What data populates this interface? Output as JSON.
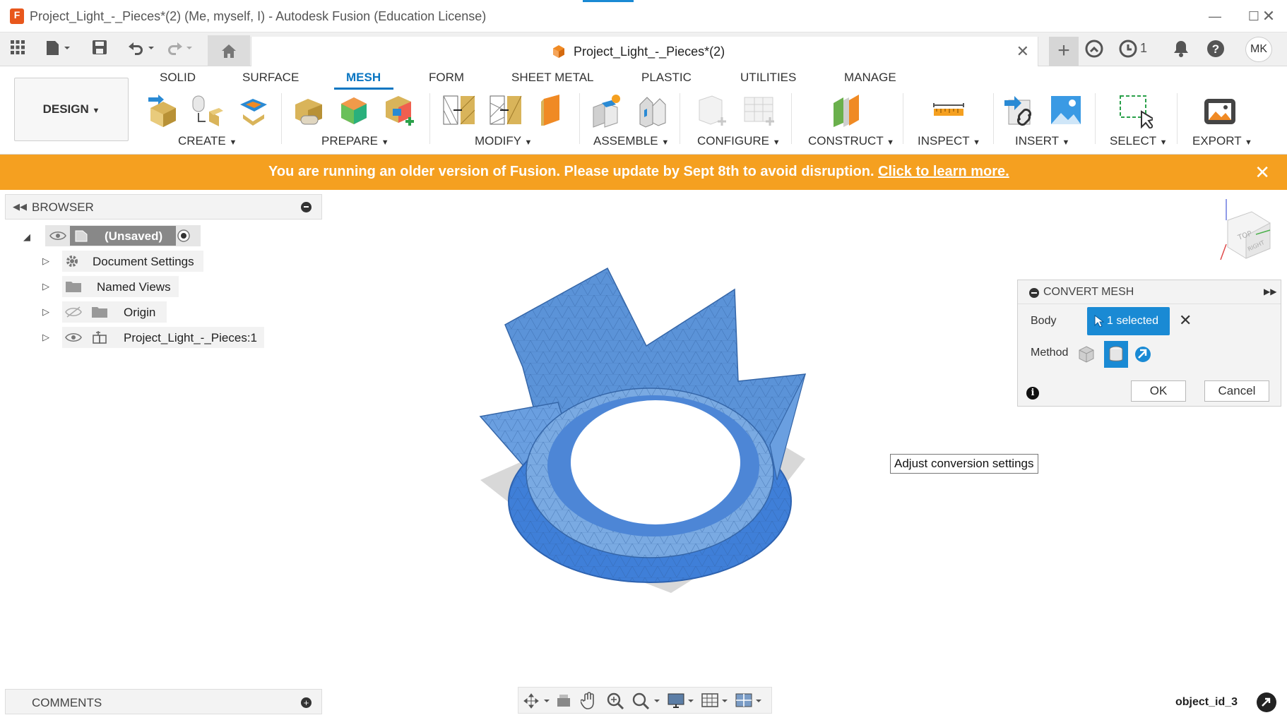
{
  "window": {
    "app_icon_letter": "F",
    "title": "Project_Light_-_Pieces*(2) (Me, myself, I) - Autodesk Fusion (Education License)",
    "minimize_icon": "minimize-icon",
    "maximize_icon": "maximize-icon",
    "close_icon": "close-icon"
  },
  "quick_access": {
    "doc_tab_label": "Project_Light_-_Pieces*(2)",
    "jobs_count": "1",
    "avatar_initials": "MK"
  },
  "ribbon": {
    "workspace_label": "DESIGN",
    "tabs": [
      "SOLID",
      "SURFACE",
      "MESH",
      "FORM",
      "SHEET METAL",
      "PLASTIC",
      "UTILITIES",
      "MANAGE"
    ],
    "active_tab": "MESH",
    "groups": [
      "CREATE",
      "PREPARE",
      "MODIFY",
      "ASSEMBLE",
      "CONFIGURE",
      "CONSTRUCT",
      "INSPECT",
      "INSERT",
      "SELECT",
      "EXPORT"
    ]
  },
  "banner": {
    "message": "You are running an older version of Fusion. Please update by Sept 8th to avoid disruption.",
    "link_text": "Click to learn more.",
    "bg_color": "#f5a020"
  },
  "browser": {
    "title": "BROWSER",
    "root_label": "(Unsaved)",
    "items": [
      "Document Settings",
      "Named Views",
      "Origin",
      "Project_Light_-_Pieces:1"
    ]
  },
  "comments": {
    "title": "COMMENTS"
  },
  "dialog": {
    "title": "CONVERT MESH",
    "body_label": "Body",
    "selection_text": "1 selected",
    "method_label": "Method",
    "ok_label": "OK",
    "cancel_label": "Cancel",
    "accent_color": "#1a8ad4"
  },
  "tooltip": {
    "text": "Adjust conversion settings"
  },
  "viewport": {
    "mesh_color": "#4a86d4"
  },
  "status": {
    "object_label": "object_id_3"
  }
}
